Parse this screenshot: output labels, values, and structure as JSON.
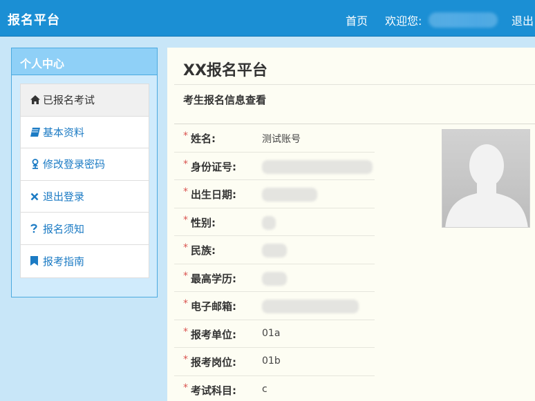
{
  "navbar": {
    "brand": "报名平台",
    "home": "首页",
    "welcome": "欢迎您:",
    "logout": "退出"
  },
  "sidebar": {
    "title": "个人中心",
    "items": [
      {
        "label": "已报名考试",
        "icon": "home-icon"
      },
      {
        "label": "基本资料",
        "icon": "book-icon"
      },
      {
        "label": "修改登录密码",
        "icon": "key-icon"
      },
      {
        "label": "退出登录",
        "icon": "close-icon"
      },
      {
        "label": "报名须知",
        "icon": "question-icon"
      },
      {
        "label": "报考指南",
        "icon": "bookmark-icon"
      }
    ]
  },
  "main": {
    "title": "XX报名平台",
    "section_title": "考生报名信息查看",
    "fields": [
      {
        "label": "姓名:",
        "value": "测试账号"
      },
      {
        "label": "身份证号:",
        "value": ""
      },
      {
        "label": "出生日期:",
        "value": ""
      },
      {
        "label": "性别:",
        "value": ""
      },
      {
        "label": "民族:",
        "value": ""
      },
      {
        "label": "最高学历:",
        "value": ""
      },
      {
        "label": "电子邮箱:",
        "value": ""
      },
      {
        "label": "报考单位:",
        "value": "01a"
      },
      {
        "label": "报考岗位:",
        "value": "01b"
      },
      {
        "label": "考试科目:",
        "value": "c"
      }
    ],
    "required_mark": "*"
  },
  "colors": {
    "navbar": "#1b8fd4",
    "sidebar_header": "#8fd0f7",
    "link": "#1c7bc4",
    "required": "#d9534f"
  }
}
